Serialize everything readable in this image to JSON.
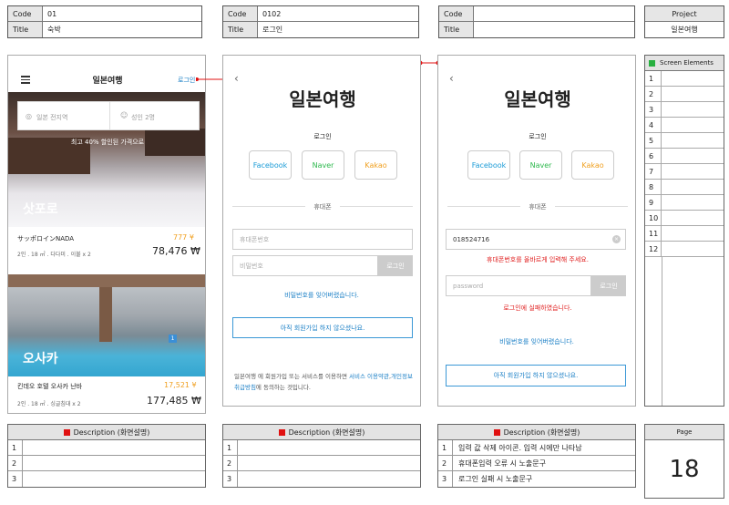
{
  "headers": [
    {
      "code_label": "Code",
      "code": "01",
      "title_label": "Title",
      "title": "숙박"
    },
    {
      "code_label": "Code",
      "code": "0102",
      "title_label": "Title",
      "title": "로그인"
    },
    {
      "code_label": "Code",
      "code": "",
      "title_label": "Title",
      "title": ""
    }
  ],
  "project": {
    "label": "Project",
    "value": "일본여행"
  },
  "screen1": {
    "app_title": "일본여행",
    "login_link": "로그인",
    "search_placeholder": "일본 전지역",
    "guests": "성인 2명",
    "promo": "최고 40% 할인된 가격으로",
    "cards": [
      {
        "city": "삿포로",
        "name": "サッポロインNADA",
        "price_small": "777 ¥",
        "desc": "2인 . 18 ㎡ . 다다미 . 이불 x 2",
        "price": "78,476 ₩"
      },
      {
        "city": "오사카",
        "name": "킨데오 호텔 오사카 난바",
        "price_small": "17,521 ¥",
        "desc": "2인 . 18 ㎡ . 싱글침대 x 2",
        "price": "177,485 ₩"
      }
    ],
    "badge": "1"
  },
  "screen2": {
    "title": "일본여행",
    "login_label": "로그인",
    "sns": [
      "Facebook",
      "Naver",
      "Kakao"
    ],
    "sns_colors": [
      "#1a9bd6",
      "#2db84d",
      "#f0a020"
    ],
    "phone_divider": "휴대폰",
    "phone_placeholder": "휴대폰번호",
    "password_placeholder": "비밀번호",
    "login_button": "로그인",
    "forgot": "비밀번호를 잊어버렸습니다.",
    "signup": "아직 회원가입 하지 않으셨나요.",
    "terms_1": "일본여행 에 회원가입 또는 서비스를 이용하면 ",
    "terms_link1": "서비스 이용약관",
    "terms_2": ",",
    "terms_link2": "개인정보 취급방침",
    "terms_3": "에 동의하는 것입니다."
  },
  "screen3": {
    "title": "일본여행",
    "login_label": "로그인",
    "sns": [
      "Facebook",
      "Naver",
      "Kakao"
    ],
    "phone_divider": "휴대폰",
    "phone_value": "018524716",
    "phone_error": "휴대폰번호를 올바르게 입력해 주세요.",
    "password_placeholder": "password",
    "login_button": "로그인",
    "login_error": "로그인에 실패하였습니다.",
    "forgot": "비밀번호를 잊어버렸습니다.",
    "signup": "아직 회원가입 하지 않으셨나요."
  },
  "screen_elements": {
    "title": "Screen Elements",
    "rows": [
      "1",
      "2",
      "3",
      "4",
      "5",
      "6",
      "7",
      "8",
      "9",
      "10",
      "11",
      "12"
    ]
  },
  "descriptions": [
    {
      "title": "Description (화면설명)",
      "rows": [
        {
          "n": "1",
          "t": ""
        },
        {
          "n": "2",
          "t": ""
        },
        {
          "n": "3",
          "t": ""
        }
      ]
    },
    {
      "title": "Description (화면설명)",
      "rows": [
        {
          "n": "1",
          "t": ""
        },
        {
          "n": "2",
          "t": ""
        },
        {
          "n": "3",
          "t": ""
        }
      ]
    },
    {
      "title": "Description (화면설명)",
      "rows": [
        {
          "n": "1",
          "t": "입력 값 삭제 아이콘. 입력 시에만 나타남"
        },
        {
          "n": "2",
          "t": "휴대폰입력 오류 시 노출문구"
        },
        {
          "n": "3",
          "t": "로그인 실패 시 노출문구"
        }
      ]
    }
  ],
  "page": {
    "label": "Page",
    "number": "18"
  }
}
